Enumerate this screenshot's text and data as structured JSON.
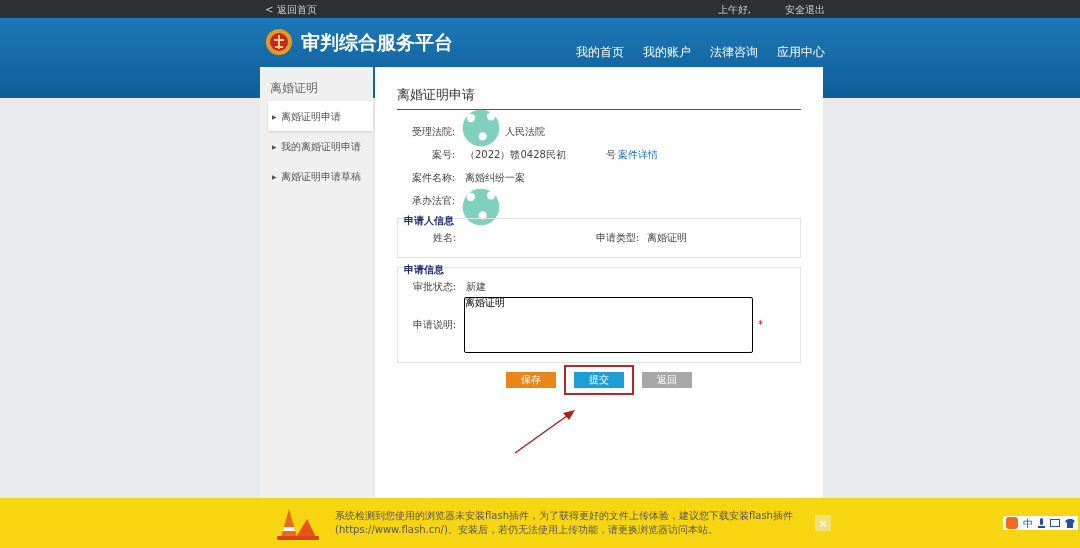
{
  "top_bar": {
    "back_link": "< 返回首页",
    "greeting": "上午好,",
    "logout": "安全退出"
  },
  "header": {
    "title": "审判综合服务平台",
    "nav": [
      {
        "label": "我的首页"
      },
      {
        "label": "我的账户"
      },
      {
        "label": "法律咨询"
      },
      {
        "label": "应用中心"
      }
    ]
  },
  "sidebar": {
    "title": "离婚证明",
    "items": [
      {
        "label": "离婚证明申请",
        "selected": true,
        "caret": "▶"
      },
      {
        "label": "我的离婚证明申请",
        "selected": false,
        "caret": "▶"
      },
      {
        "label": "离婚证明申请草稿",
        "selected": false,
        "caret": "▶"
      }
    ]
  },
  "form": {
    "title": "离婚证明申请",
    "fields": [
      {
        "label": "受理法院:",
        "value": "人民法院",
        "redacted": true
      },
      {
        "label": "案号:",
        "value": "（2022）赣0428民初",
        "suffix": "号",
        "link": "案件详情",
        "redacted": false
      },
      {
        "label": "案件名称:",
        "value": "离婚纠纷一案",
        "redacted": false
      },
      {
        "label": "承办法官:",
        "redacted": true
      }
    ],
    "applicant_section": {
      "title": "申请人信息",
      "name_label": "姓名:",
      "type_label": "申请类型:",
      "type_value": "离婚证明"
    },
    "application_section": {
      "title": "申请信息",
      "status_label": "审批状态:",
      "status_value": "新建",
      "description_label": "申请说明:",
      "description_value": "离婚证明",
      "required_mark": "*"
    },
    "buttons": [
      {
        "label": "保存",
        "kind": "save",
        "highlighted": false
      },
      {
        "label": "提交",
        "kind": "submit",
        "highlighted": true
      },
      {
        "label": "返回",
        "kind": "back",
        "highlighted": false
      }
    ]
  },
  "flash_notice": {
    "text": "系统检测到您使用的浏览器未安装flash插件，为了获得更好的文件上传体验，建议您下载安装flash插件(https://www.flash.cn/)。安装后，若仍无法使用上传功能，请更换浏览器访问本站。",
    "close": "×"
  },
  "ime_bar": {
    "mode": "中"
  }
}
